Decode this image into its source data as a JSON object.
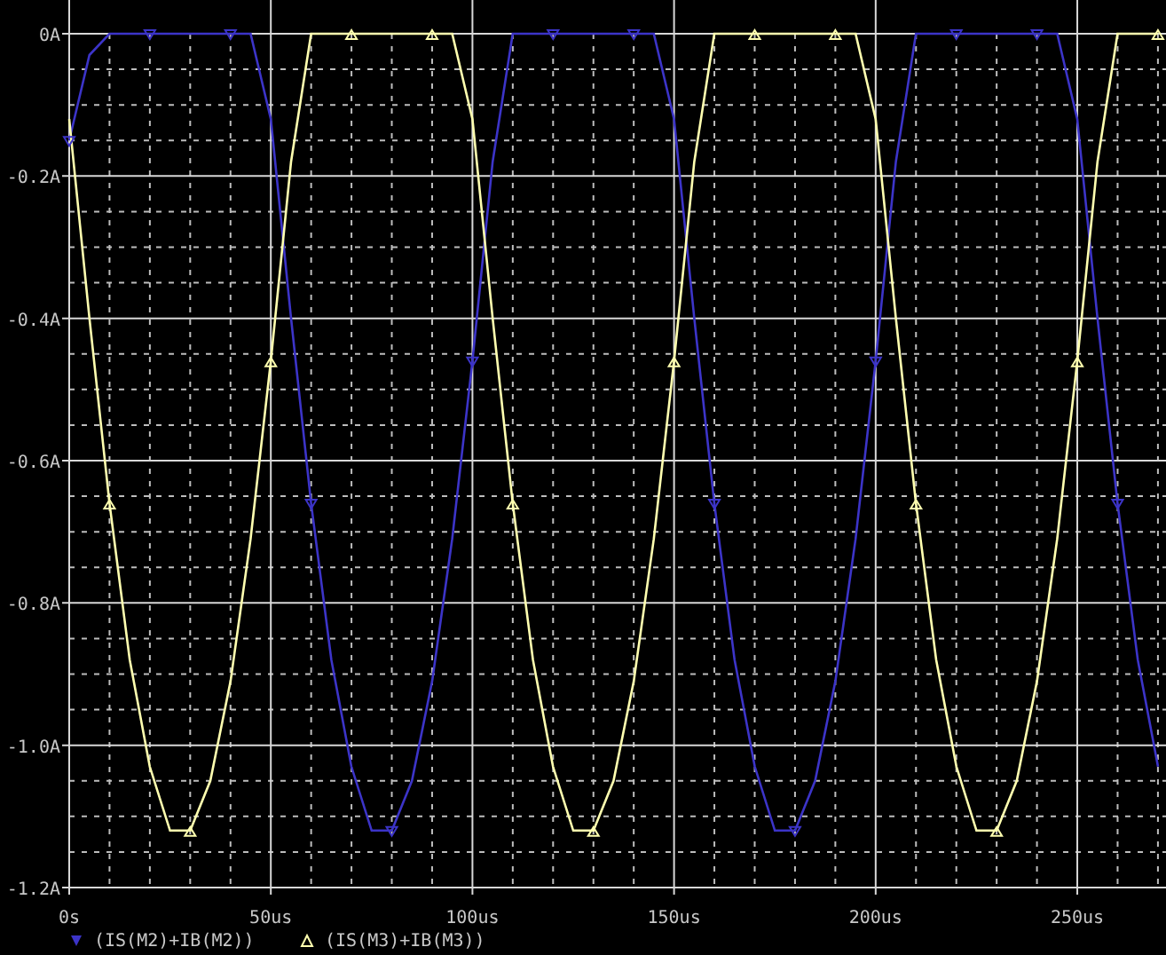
{
  "chart_data": {
    "type": "line",
    "x": [
      0,
      5,
      10,
      15,
      20,
      25,
      30,
      35,
      40,
      45,
      50,
      55,
      60,
      65,
      70,
      75,
      80,
      85,
      90,
      95,
      100,
      105,
      110,
      115,
      120,
      125,
      130,
      135,
      140,
      145,
      150,
      155,
      160,
      165,
      170,
      175,
      180,
      185,
      190,
      195,
      200,
      205,
      210,
      215,
      220,
      225,
      230,
      235,
      240,
      245,
      250,
      255,
      260,
      265,
      270
    ],
    "grid": true,
    "legend": true,
    "xlim": [
      0,
      272
    ],
    "ylim": [
      -1.2,
      0
    ],
    "xticks": [
      {
        "value": 0,
        "label": "0s"
      },
      {
        "value": 50,
        "label": "50us"
      },
      {
        "value": 100,
        "label": "100us"
      },
      {
        "value": 150,
        "label": "150us"
      },
      {
        "value": 200,
        "label": "200us"
      },
      {
        "value": 250,
        "label": "250us"
      }
    ],
    "yticks": [
      {
        "value": 0,
        "label": "0A"
      },
      {
        "value": -0.2,
        "label": "-0.2A"
      },
      {
        "value": -0.4,
        "label": "-0.4A"
      },
      {
        "value": -0.6,
        "label": "-0.6A"
      },
      {
        "value": -0.8,
        "label": "-0.8A"
      },
      {
        "value": -1.0,
        "label": "-1.0A"
      },
      {
        "value": -1.2,
        "label": "-1.2A"
      }
    ],
    "series": [
      {
        "name": "(IS(M2)+IB(M2))",
        "color": "#3c34c8",
        "values": [
          -0.15,
          -0.03,
          0,
          0,
          0,
          0,
          0,
          0,
          0,
          0,
          -0.12,
          -0.4,
          -0.66,
          -0.88,
          -1.03,
          -1.12,
          -1.12,
          -1.05,
          -0.91,
          -0.71,
          -0.46,
          -0.18,
          0,
          0,
          0,
          0,
          0,
          0,
          0,
          0,
          -0.12,
          -0.4,
          -0.66,
          -0.88,
          -1.03,
          -1.12,
          -1.12,
          -1.05,
          -0.91,
          -0.71,
          -0.46,
          -0.18,
          0,
          0,
          0,
          0,
          0,
          0,
          0,
          0,
          -0.12,
          -0.4,
          -0.66,
          -0.88,
          -1.03
        ]
      },
      {
        "name": "(IS(M3)+IB(M3))",
        "color": "#ffffb0",
        "values": [
          -0.12,
          -0.4,
          -0.66,
          -0.88,
          -1.03,
          -1.12,
          -1.12,
          -1.05,
          -0.91,
          -0.71,
          -0.46,
          -0.18,
          0,
          0,
          0,
          0,
          0,
          0,
          0,
          0,
          -0.12,
          -0.4,
          -0.66,
          -0.88,
          -1.03,
          -1.12,
          -1.12,
          -1.05,
          -0.91,
          -0.71,
          -0.46,
          -0.18,
          0,
          0,
          0,
          0,
          0,
          0,
          0,
          0,
          -0.12,
          -0.4,
          -0.66,
          -0.88,
          -1.03,
          -1.12,
          -1.12,
          -1.05,
          -0.91,
          -0.71,
          -0.46,
          -0.18,
          0,
          0,
          0
        ]
      }
    ]
  }
}
